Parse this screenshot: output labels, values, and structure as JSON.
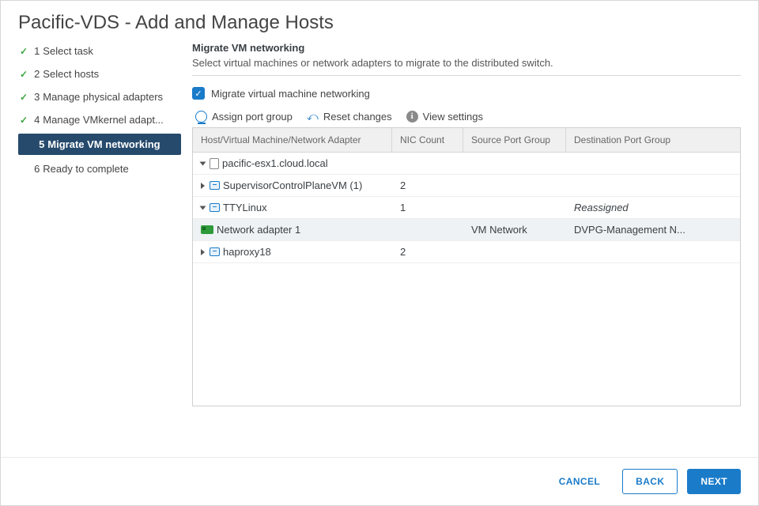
{
  "title": "Pacific-VDS - Add and Manage Hosts",
  "steps": [
    {
      "num": "1",
      "label": "Select task"
    },
    {
      "num": "2",
      "label": "Select hosts"
    },
    {
      "num": "3",
      "label": "Manage physical adapters"
    },
    {
      "num": "4",
      "label": "Manage VMkernel adapt..."
    },
    {
      "num": "5",
      "label": "Migrate VM networking"
    },
    {
      "num": "6",
      "label": "Ready to complete"
    }
  ],
  "section": {
    "heading": "Migrate VM networking",
    "subheading": "Select virtual machines or network adapters to migrate to the distributed switch."
  },
  "checkbox_label": "Migrate virtual machine networking",
  "toolbar": {
    "assign": "Assign port group",
    "reset": "Reset changes",
    "view": "View settings"
  },
  "columns": {
    "name": "Host/Virtual Machine/Network Adapter",
    "nic": "NIC Count",
    "src": "Source Port Group",
    "dst": "Destination Port Group"
  },
  "tree": {
    "host": "pacific-esx1.cloud.local",
    "vm1": {
      "name": "SupervisorControlPlaneVM (1)",
      "nic": "2"
    },
    "vm2": {
      "name": "TTYLinux",
      "nic": "1",
      "dst": "Reassigned"
    },
    "adapter": {
      "name": "Network adapter 1",
      "src": "VM Network",
      "dst": "DVPG-Management N..."
    },
    "vm3": {
      "name": "haproxy18",
      "nic": "2"
    }
  },
  "footer": {
    "cancel": "CANCEL",
    "back": "BACK",
    "next": "NEXT"
  }
}
